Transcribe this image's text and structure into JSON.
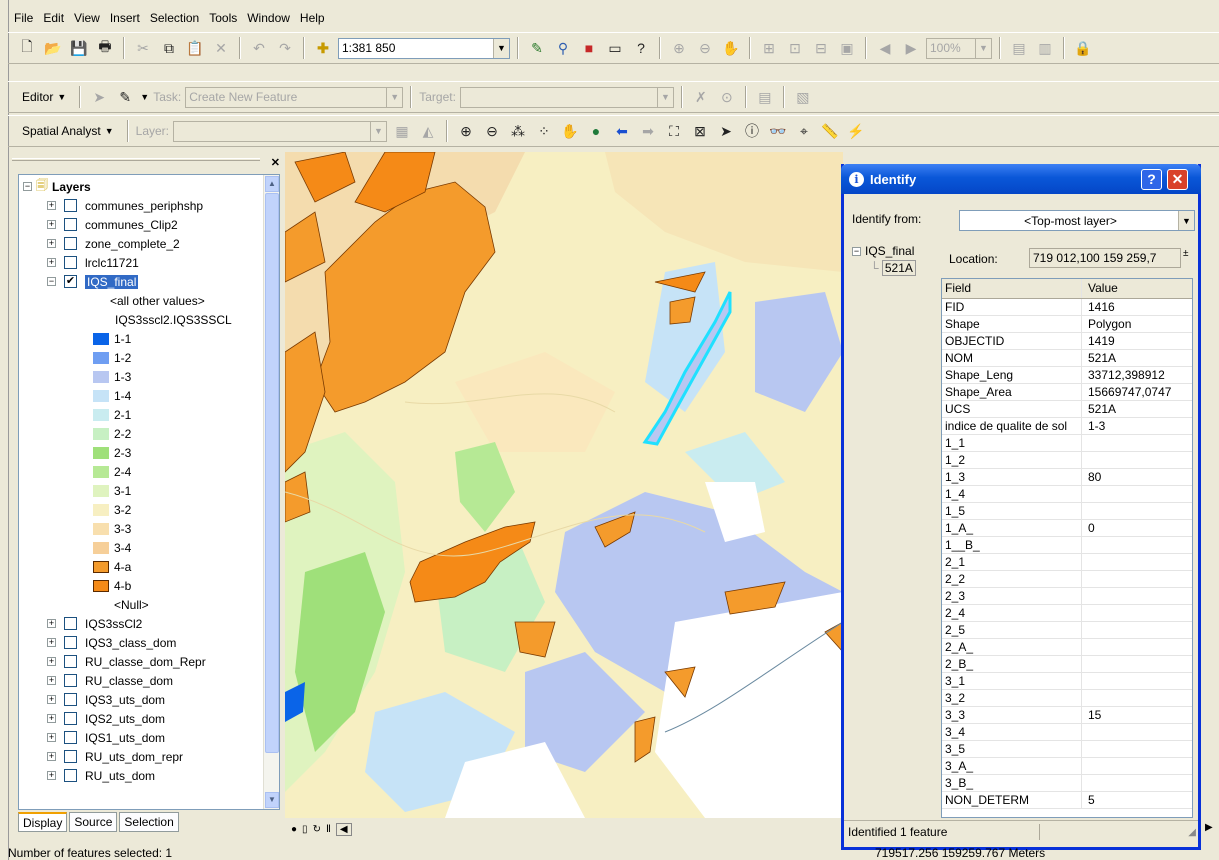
{
  "menu": [
    "File",
    "Edit",
    "View",
    "Insert",
    "Selection",
    "Tools",
    "Window",
    "Help"
  ],
  "toolbar_std": {
    "scale": "1:381 850",
    "zoom_pct": "100%"
  },
  "toolbar_editor": {
    "editor_label": "Editor",
    "task_label": "Task:",
    "task_value": "Create New Feature",
    "target_label": "Target:"
  },
  "toolbar_spatial": {
    "spatial_label": "Spatial Analyst",
    "layer_label": "Layer:"
  },
  "toc": {
    "root": "Layers",
    "layers_top": [
      {
        "name": "communes_periphshp",
        "checked": false
      },
      {
        "name": "communes_Clip2",
        "checked": false
      },
      {
        "name": "zone_complete_2",
        "checked": false
      },
      {
        "name": "lrclc11721",
        "checked": false
      },
      {
        "name": "IQS_final",
        "checked": true
      }
    ],
    "legend_all_other": "<all other values>",
    "legend_field": "IQS3sscl2.IQS3SSCL",
    "legend": [
      {
        "label": "1-1",
        "color": "#0a64e8"
      },
      {
        "label": "1-2",
        "color": "#6f9ef2"
      },
      {
        "label": "1-3",
        "color": "#b8c7f1"
      },
      {
        "label": "1-4",
        "color": "#c6e3f7"
      },
      {
        "label": "2-1",
        "color": "#c9ecf0"
      },
      {
        "label": "2-2",
        "color": "#c7f0c3"
      },
      {
        "label": "2-3",
        "color": "#9fe07a"
      },
      {
        "label": "2-4",
        "color": "#b6e995"
      },
      {
        "label": "3-1",
        "color": "#dff3bf"
      },
      {
        "label": "3-2",
        "color": "#f7efc2"
      },
      {
        "label": "3-3",
        "color": "#f8dfae"
      },
      {
        "label": "3-4",
        "color": "#f6cf99"
      },
      {
        "label": "4-a",
        "color": "#f49b2c"
      },
      {
        "label": "4-b",
        "color": "#f58a17"
      }
    ],
    "legend_null": "<Null>",
    "layers_bottom": [
      "IQS3ssCl2",
      "IQS3_class_dom",
      "RU_classe_dom_Repr",
      "RU_classe_dom",
      "IQS3_uts_dom",
      "IQS2_uts_dom",
      "IQS1_uts_dom",
      "RU_uts_dom_repr",
      "RU_uts_dom"
    ],
    "tabs": [
      "Display",
      "Source",
      "Selection"
    ]
  },
  "identify": {
    "title": "Identify",
    "from_label": "Identify from:",
    "from_value": "<Top-most layer>",
    "tree_layer": "IQS_final",
    "tree_feature": "521A",
    "location_label": "Location:",
    "location_value": "719 012,100  159 259,7",
    "col_field": "Field",
    "col_value": "Value",
    "rows": [
      [
        "FID",
        "1416"
      ],
      [
        "Shape",
        "Polygon"
      ],
      [
        "OBJECTID",
        "1419"
      ],
      [
        "NOM",
        "521A"
      ],
      [
        "Shape_Leng",
        "33712,398912"
      ],
      [
        "Shape_Area",
        "15669747,0747"
      ],
      [
        "UCS",
        "521A"
      ],
      [
        "indice de qualite de sol",
        "1-3"
      ],
      [
        "1_1",
        ""
      ],
      [
        "1_2",
        ""
      ],
      [
        "1_3",
        "80"
      ],
      [
        "1_4",
        ""
      ],
      [
        "1_5",
        ""
      ],
      [
        "1_A_",
        "0"
      ],
      [
        "1__B_",
        ""
      ],
      [
        "2_1",
        ""
      ],
      [
        "2_2",
        ""
      ],
      [
        "2_3",
        ""
      ],
      [
        "2_4",
        ""
      ],
      [
        "2_5",
        ""
      ],
      [
        "2_A_",
        ""
      ],
      [
        "2_B_",
        ""
      ],
      [
        "3_1",
        ""
      ],
      [
        "3_2",
        ""
      ],
      [
        "3_3",
        "15"
      ],
      [
        "3_4",
        ""
      ],
      [
        "3_5",
        ""
      ],
      [
        "3_A_",
        ""
      ],
      [
        "3_B_",
        ""
      ],
      [
        "NON_DETERM",
        "5"
      ]
    ],
    "status": "Identified 1 feature"
  },
  "status": {
    "selected": "Number of features selected: 1",
    "coords": "719517.256  159259.767 Meters"
  }
}
